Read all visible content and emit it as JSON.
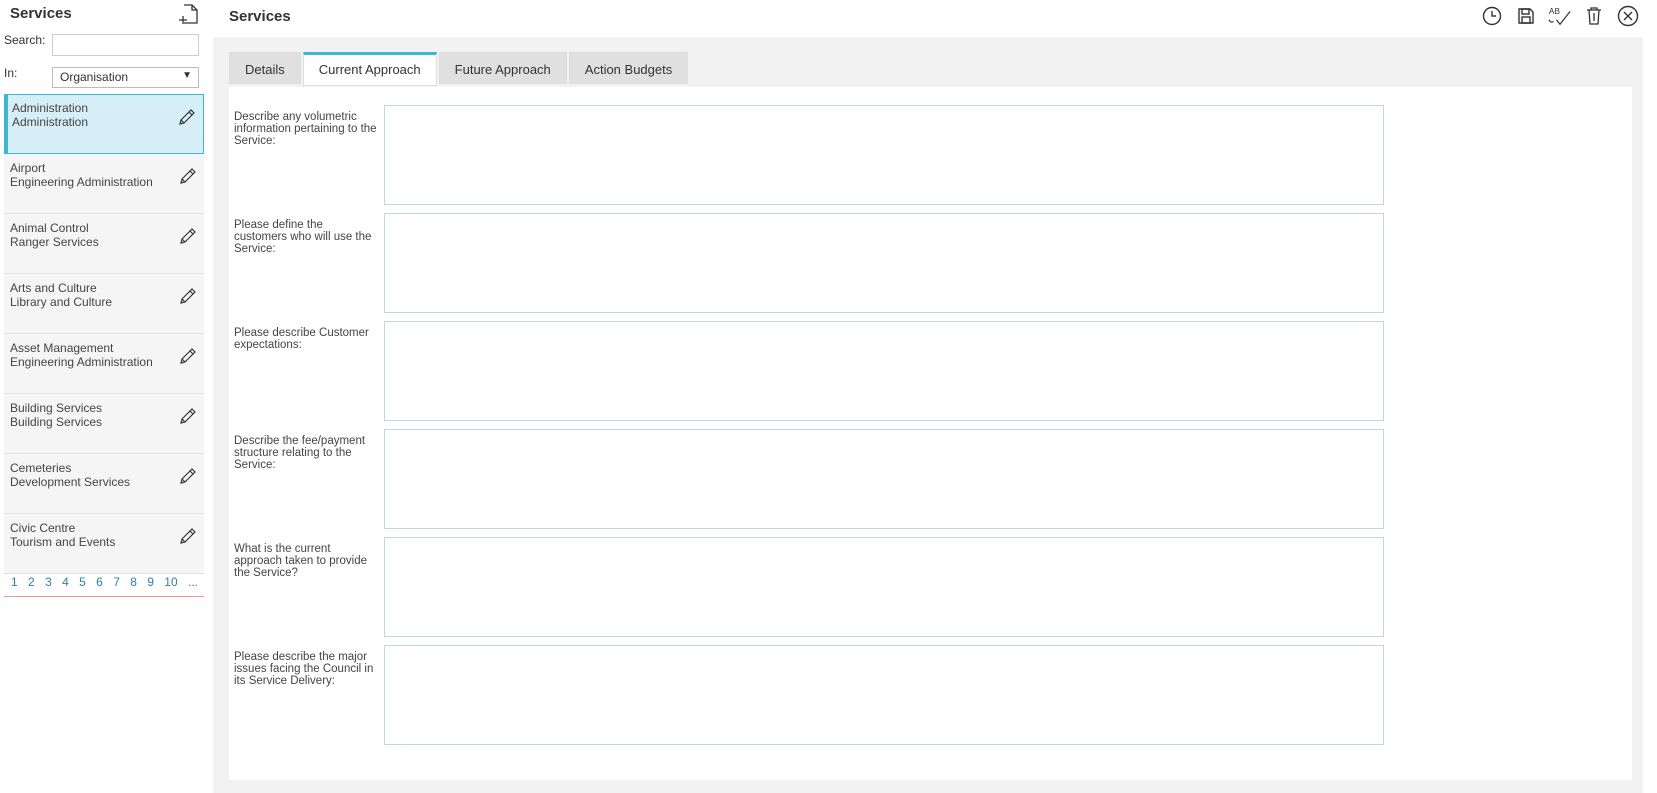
{
  "sidebar": {
    "title": "Services",
    "search_label": "Search:",
    "search_value": "",
    "in_label": "In:",
    "in_value": "Organisation",
    "items": [
      {
        "line1": "Administration",
        "line2": "Administration"
      },
      {
        "line1": "Airport",
        "line2": "Engineering Administration"
      },
      {
        "line1": "Animal Control",
        "line2": "Ranger Services"
      },
      {
        "line1": "Arts and Culture",
        "line2": "Library and Culture"
      },
      {
        "line1": "Asset Management",
        "line2": "Engineering Administration"
      },
      {
        "line1": "Building Services",
        "line2": "Building Services"
      },
      {
        "line1": "Cemeteries",
        "line2": "Development Services"
      },
      {
        "line1": "Civic Centre",
        "line2": "Tourism and Events"
      }
    ],
    "pages": [
      "1",
      "2",
      "3",
      "4",
      "5",
      "6",
      "7",
      "8",
      "9",
      "10",
      "..."
    ]
  },
  "main": {
    "title": "Services",
    "tabs": [
      {
        "label": "Details"
      },
      {
        "label": "Current Approach"
      },
      {
        "label": "Future Approach"
      },
      {
        "label": "Action Budgets"
      }
    ],
    "fields": [
      {
        "label": "Describe any volumetric information pertaining to the Service:",
        "value": ""
      },
      {
        "label": "Please define the customers who will use the Service:",
        "value": ""
      },
      {
        "label": "Please describe Customer expectations:",
        "value": ""
      },
      {
        "label": "Describe the fee/payment structure relating to the Service:",
        "value": ""
      },
      {
        "label": "What is the current approach taken to provide the Service?",
        "value": ""
      },
      {
        "label": "Please describe the major issues facing the Council in its Service Delivery:",
        "value": ""
      }
    ]
  },
  "toolbar": {
    "icons": [
      "history-icon",
      "save-icon",
      "spellcheck-icon",
      "delete-icon",
      "close-icon"
    ],
    "spellcheck_text": "AB"
  },
  "colors": {
    "accent": "#3cb6d3",
    "active_item_bg": "#d6eef6",
    "link": "#2c7fb8"
  }
}
